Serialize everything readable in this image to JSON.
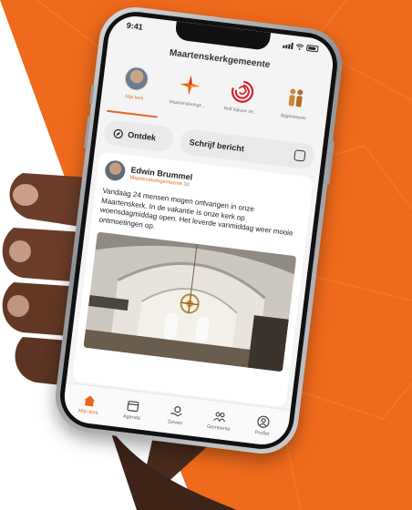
{
  "colors": {
    "accent": "#e8671c",
    "background": "#ef6a1c"
  },
  "status_bar": {
    "time": "9:41"
  },
  "app": {
    "title": "Maartenskerkgemeente"
  },
  "tabs": [
    {
      "label": "Mijn kerk",
      "icon": "profile-avatar",
      "active": true
    },
    {
      "label": "Maartenskerkge...",
      "icon": "star-burst-icon",
      "active": false
    },
    {
      "label": "Rolf Kijkuur de...",
      "icon": "swirl-logo-icon",
      "active": false
    },
    {
      "label": "Bijgemeente",
      "icon": "people-icon",
      "active": false
    }
  ],
  "actions": {
    "discover_label": "Ontdek",
    "write_label": "Schrijf bericht"
  },
  "post": {
    "author": "Edwin Brummel",
    "organization": "Maartenskerkgemeente",
    "time": "3d",
    "text": "Vandaag 24 mensen mogen ontvangen in onze Maartenskerk. In de vakantie is onze kerk op woensdagmiddag open. Het leverde vanmiddag weer mooie ontmoetingen op."
  },
  "bottom_nav": [
    {
      "label": "Mijn kerk",
      "icon": "home-icon",
      "active": true
    },
    {
      "label": "Agenda",
      "icon": "calendar-icon",
      "active": false
    },
    {
      "label": "Geven",
      "icon": "give-icon",
      "active": false
    },
    {
      "label": "Gemeente",
      "icon": "community-icon",
      "active": false
    },
    {
      "label": "Profiel",
      "icon": "profile-icon",
      "active": false
    }
  ]
}
